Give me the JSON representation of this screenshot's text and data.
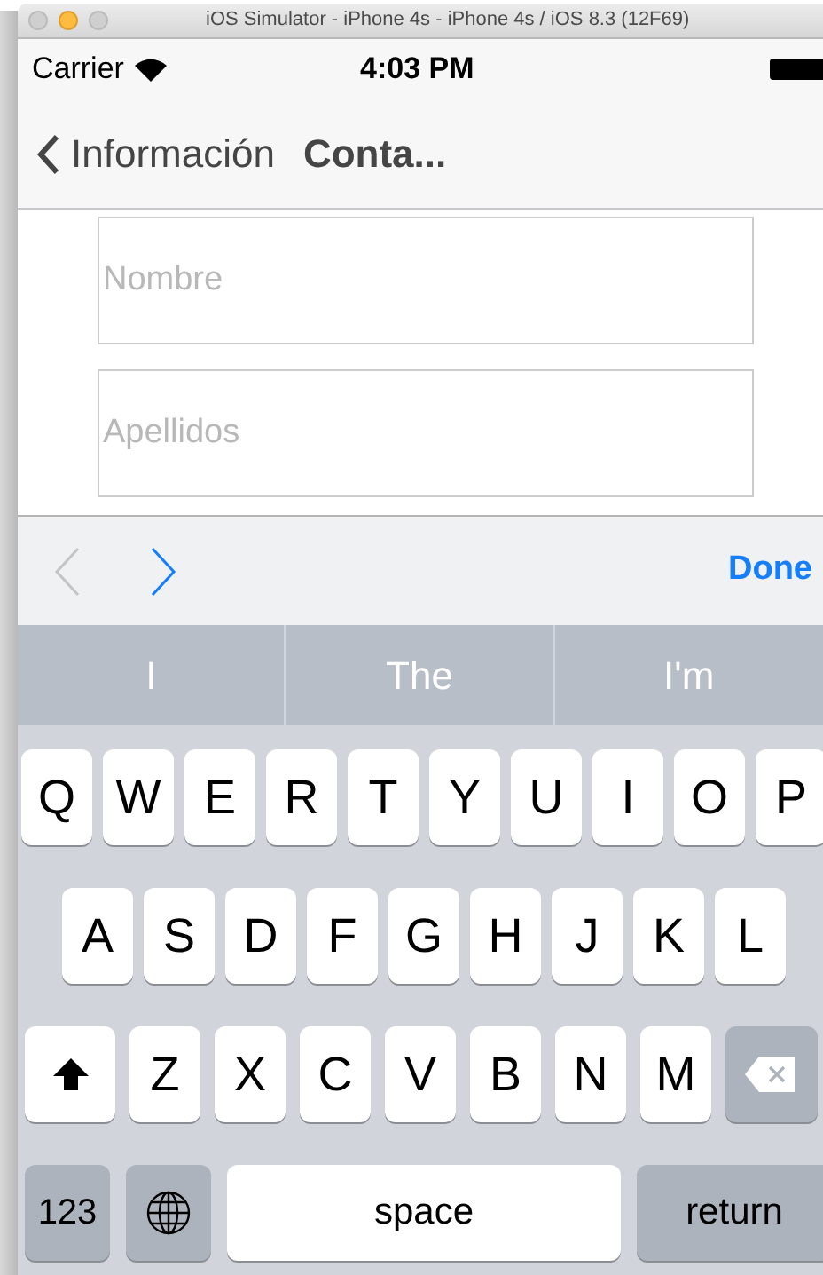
{
  "window": {
    "title": "iOS Simulator - iPhone 4s - iPhone 4s / iOS 8.3 (12F69)"
  },
  "status_bar": {
    "carrier": "Carrier",
    "time": "4:03 PM"
  },
  "nav_bar": {
    "back_label": "Información",
    "title": "Conta..."
  },
  "form": {
    "fields": [
      {
        "placeholder": "Nombre"
      },
      {
        "placeholder": "Apellidos"
      }
    ]
  },
  "toolbar": {
    "previous": {
      "disabled": true
    },
    "next": {
      "disabled": false
    },
    "done": "Done"
  },
  "suggestions": [
    "I",
    "The",
    "I'm"
  ],
  "keyboard": {
    "rows": [
      [
        {
          "kind": "letter",
          "label": "Q"
        },
        {
          "kind": "letter",
          "label": "W"
        },
        {
          "kind": "letter",
          "label": "E"
        },
        {
          "kind": "letter",
          "label": "R"
        },
        {
          "kind": "letter",
          "label": "T"
        },
        {
          "kind": "letter",
          "label": "Y"
        },
        {
          "kind": "letter",
          "label": "U"
        },
        {
          "kind": "letter",
          "label": "I"
        },
        {
          "kind": "letter",
          "label": "O"
        },
        {
          "kind": "letter",
          "label": "P"
        }
      ],
      [
        {
          "kind": "letter",
          "label": "A"
        },
        {
          "kind": "letter",
          "label": "S"
        },
        {
          "kind": "letter",
          "label": "D"
        },
        {
          "kind": "letter",
          "label": "F"
        },
        {
          "kind": "letter",
          "label": "G"
        },
        {
          "kind": "letter",
          "label": "H"
        },
        {
          "kind": "letter",
          "label": "J"
        },
        {
          "kind": "letter",
          "label": "K"
        },
        {
          "kind": "letter",
          "label": "L"
        }
      ],
      [
        {
          "kind": "shift"
        },
        {
          "kind": "letter",
          "label": "Z"
        },
        {
          "kind": "letter",
          "label": "X"
        },
        {
          "kind": "letter",
          "label": "C"
        },
        {
          "kind": "letter",
          "label": "V"
        },
        {
          "kind": "letter",
          "label": "B"
        },
        {
          "kind": "letter",
          "label": "N"
        },
        {
          "kind": "letter",
          "label": "M"
        },
        {
          "kind": "delete"
        }
      ]
    ],
    "bottom_row": [
      {
        "kind": "numbers",
        "label": "123"
      },
      {
        "kind": "globe"
      },
      {
        "kind": "space",
        "label": "space"
      },
      {
        "kind": "return",
        "label": "return"
      }
    ]
  }
}
